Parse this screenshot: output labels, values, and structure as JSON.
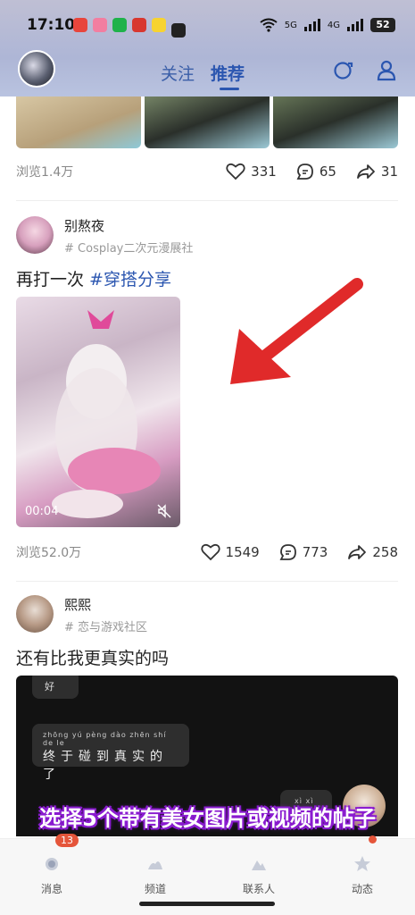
{
  "status_bar": {
    "time": "17:10",
    "net_5g": "5G",
    "net_4g": "4G",
    "battery": "52"
  },
  "header": {
    "tabs": [
      {
        "label": "关注",
        "active": false
      },
      {
        "label": "推荐",
        "active": true
      }
    ]
  },
  "feed": {
    "post0": {
      "views": "浏览1.4万",
      "likes": "331",
      "comments": "65",
      "shares": "31"
    },
    "post1": {
      "author": "别熬夜",
      "group": "Cosplay二次元漫展社",
      "text_plain": "再打一次 ",
      "text_tag": "#穿搭分享",
      "video_duration": "00:04",
      "views": "浏览52.0万",
      "likes": "1549",
      "comments": "773",
      "shares": "258"
    },
    "post2": {
      "author": "熙熙",
      "group": "恋与游戏社区",
      "text": "还有比我更真实的吗",
      "bubble_top": "好",
      "bubble_pinyin": "zhōng yú pèng dào zhēn shí de le",
      "bubble_text": "终于碰到真实的了",
      "bubble_right_pinyin": "xì xì"
    }
  },
  "overlay_caption": "选择5个带有美女图片或视频的帖子",
  "bottom_nav": {
    "items": [
      {
        "label": "消息",
        "badge": "13"
      },
      {
        "label": "频道"
      },
      {
        "label": "联系人"
      },
      {
        "label": "动态"
      }
    ]
  },
  "colors": {
    "accent": "#2b56b0",
    "badge": "#e5553a",
    "caption_outline": "#8a1bd0"
  }
}
